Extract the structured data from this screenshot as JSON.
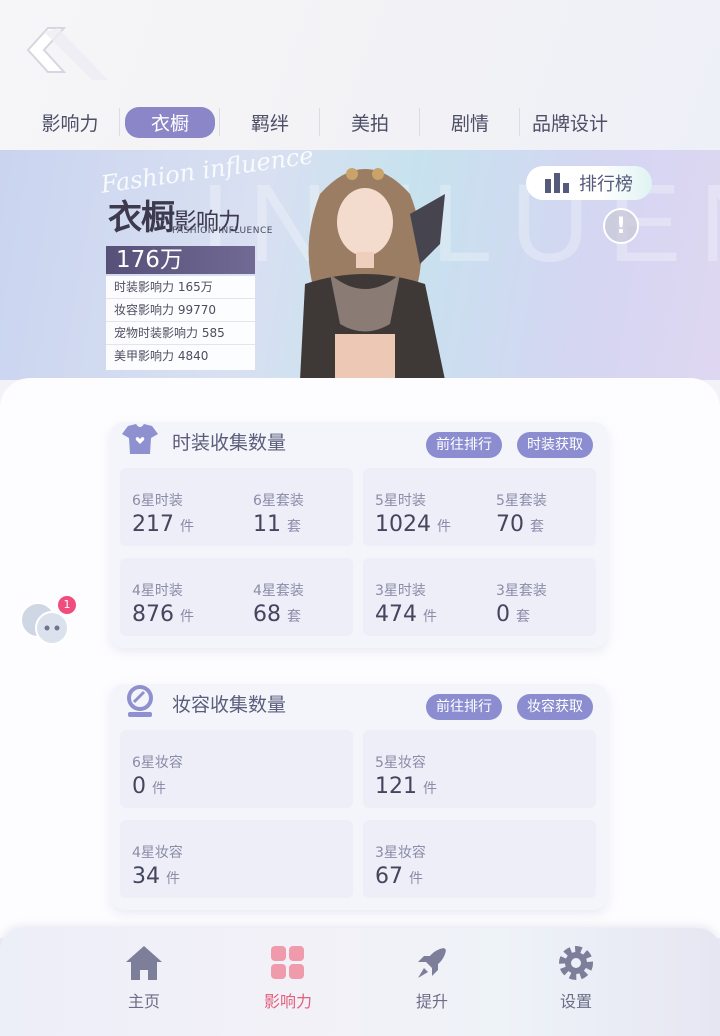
{
  "header": {
    "tabs": [
      {
        "label": "影响力",
        "active": false
      },
      {
        "label": "衣橱",
        "active": true
      },
      {
        "label": "羁绊",
        "active": false
      },
      {
        "label": "美拍",
        "active": false
      },
      {
        "label": "剧情",
        "active": false
      },
      {
        "label": "品牌设计",
        "active": false
      }
    ]
  },
  "banner": {
    "watermark": "INFLUENCE",
    "script_text": "Fashion influence",
    "title_main": "衣橱",
    "title_small": "影响力",
    "subtitle": "FASHION INFLUENCE",
    "total": "176万",
    "stats": [
      "时装影响力 165万",
      "妆容影响力 99770",
      "宠物时装影响力 585",
      "美甲影响力 4840"
    ],
    "rank_button": "排行榜",
    "info_icon": "!"
  },
  "fashion_card": {
    "title": "时装收集数量",
    "btn_rank": "前往排行",
    "btn_get": "时装获取",
    "cells": [
      [
        {
          "label": "6星时装",
          "value": "217",
          "unit": "件"
        },
        {
          "label": "6星套装",
          "value": "11",
          "unit": "套"
        }
      ],
      [
        {
          "label": "5星时装",
          "value": "1024",
          "unit": "件"
        },
        {
          "label": "5星套装",
          "value": "70",
          "unit": "套"
        }
      ],
      [
        {
          "label": "4星时装",
          "value": "876",
          "unit": "件"
        },
        {
          "label": "4星套装",
          "value": "68",
          "unit": "套"
        }
      ],
      [
        {
          "label": "3星时装",
          "value": "474",
          "unit": "件"
        },
        {
          "label": "3星套装",
          "value": "0",
          "unit": "套"
        }
      ]
    ]
  },
  "makeup_card": {
    "title": "妆容收集数量",
    "btn_rank": "前往排行",
    "btn_get": "妆容获取",
    "cells": [
      {
        "label": "6星妆容",
        "value": "0",
        "unit": "件"
      },
      {
        "label": "5星妆容",
        "value": "121",
        "unit": "件"
      },
      {
        "label": "4星妆容",
        "value": "34",
        "unit": "件"
      },
      {
        "label": "3星妆容",
        "value": "67",
        "unit": "件"
      }
    ]
  },
  "chat": {
    "badge": "1"
  },
  "nav": [
    {
      "label": "主页",
      "icon": "home-icon",
      "active": false
    },
    {
      "label": "影响力",
      "icon": "grid-icon",
      "active": true
    },
    {
      "label": "提升",
      "icon": "rocket-icon",
      "active": false
    },
    {
      "label": "设置",
      "icon": "gear-icon",
      "active": false
    }
  ],
  "colors": {
    "accent": "#8b8dd0",
    "active_tab": "#8b86c8",
    "active_nav": "#e2607a",
    "badge": "#ef4d7e"
  }
}
